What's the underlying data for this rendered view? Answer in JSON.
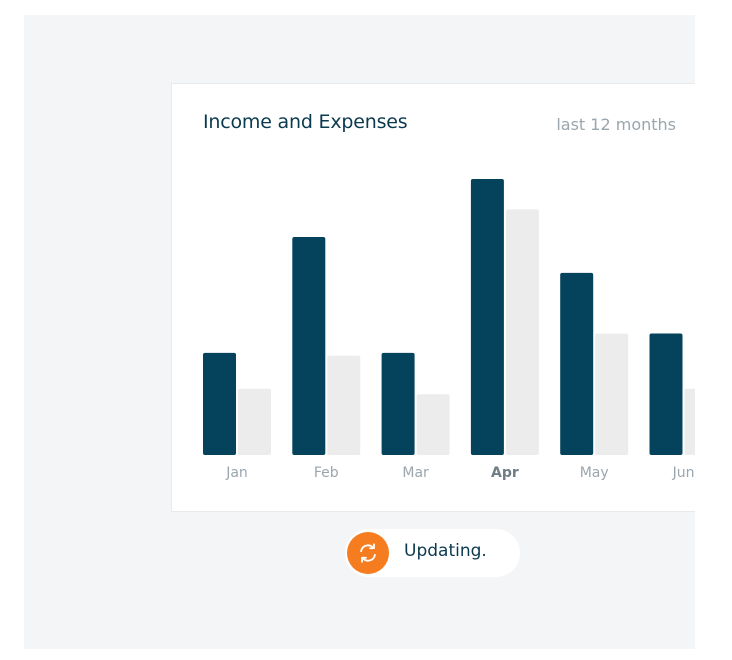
{
  "card": {
    "title": "Income and Expenses",
    "range_label": "last 12 months"
  },
  "status": {
    "text": "Updating.",
    "icon": "refresh-icon",
    "icon_color": "#f57c1f"
  },
  "colors": {
    "income": "#05425c",
    "expenses": "#ececec",
    "tick_label": "#9aa6ad",
    "tick_label_active": "#6f7c84"
  },
  "chart_data": {
    "type": "bar",
    "title": "Income and Expenses",
    "subtitle": "last 12 months",
    "categories": [
      "Jan",
      "Feb",
      "Mar",
      "Apr",
      "May",
      "Jun"
    ],
    "active_category": "Apr",
    "series": [
      {
        "values": [
          37,
          79,
          37,
          100,
          66,
          44
        ]
      },
      {
        "values": [
          24,
          36,
          22,
          89,
          44,
          24
        ]
      }
    ],
    "ylim": [
      0,
      100
    ],
    "grid": false,
    "legend": "none"
  }
}
